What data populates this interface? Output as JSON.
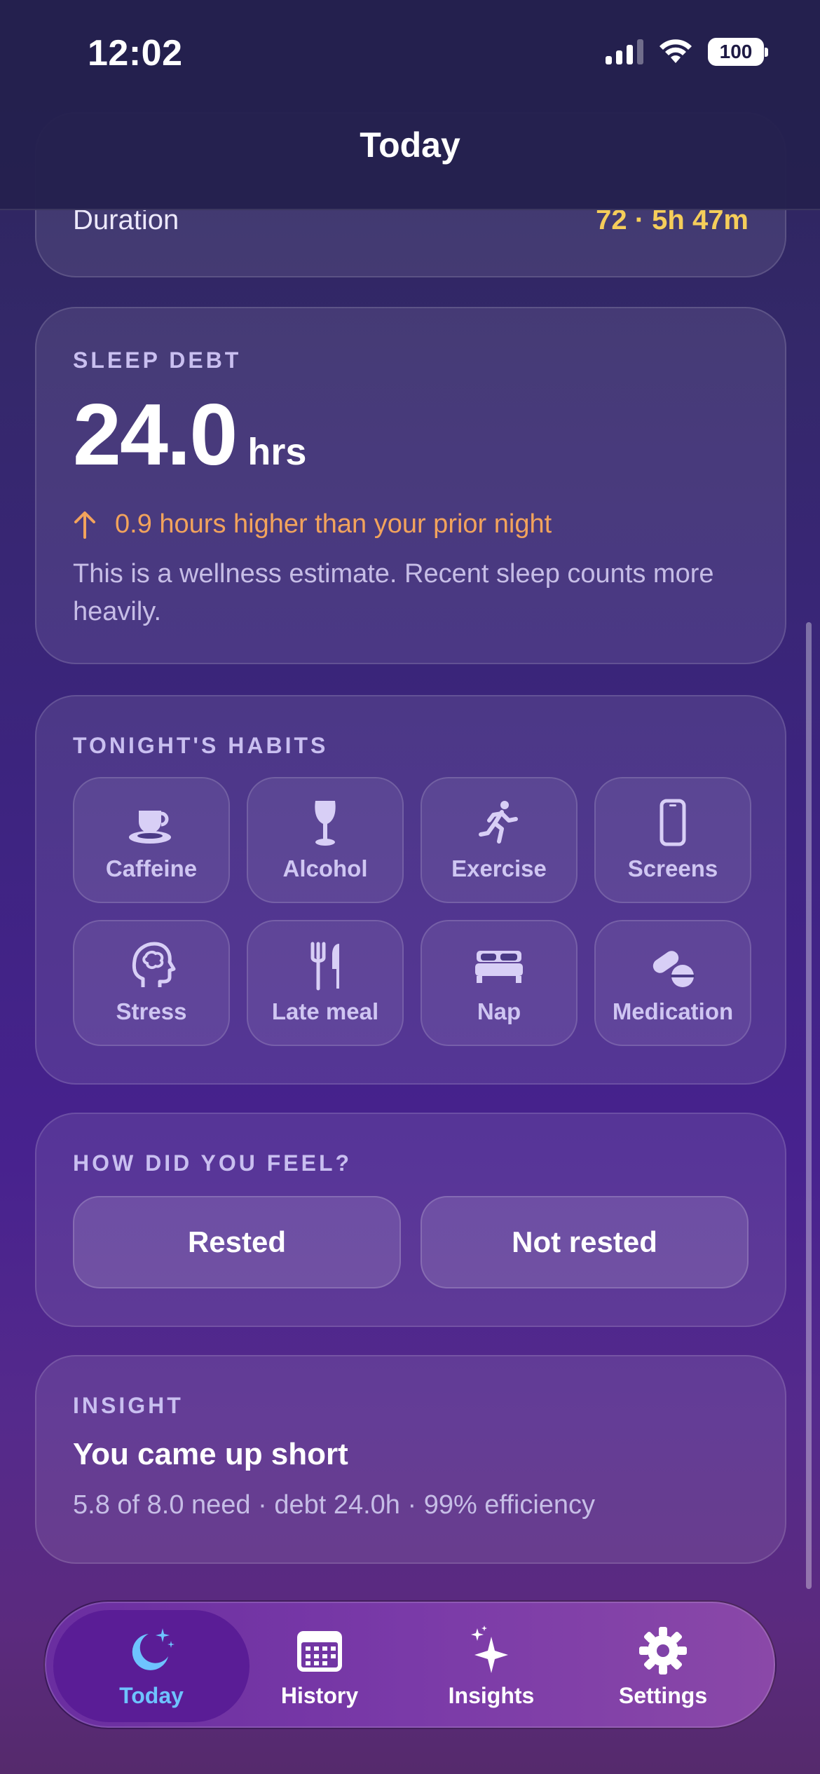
{
  "status_bar": {
    "time": "12:02",
    "battery": "100"
  },
  "header": {
    "title": "Today"
  },
  "duration": {
    "label": "Duration",
    "value": "72 · 5h 47m"
  },
  "sleep_debt": {
    "label": "SLEEP DEBT",
    "value": "24.0",
    "unit": "hrs",
    "change": "0.9 hours higher than your prior night",
    "note": "This is a wellness estimate. Recent sleep counts more heavily."
  },
  "habits": {
    "label": "TONIGHT'S HABITS",
    "items": [
      {
        "label": "Caffeine",
        "icon": "cup-icon"
      },
      {
        "label": "Alcohol",
        "icon": "wine-glass-icon"
      },
      {
        "label": "Exercise",
        "icon": "running-icon"
      },
      {
        "label": "Screens",
        "icon": "phone-icon"
      },
      {
        "label": "Stress",
        "icon": "brain-head-icon"
      },
      {
        "label": "Late meal",
        "icon": "fork-knife-icon"
      },
      {
        "label": "Nap",
        "icon": "bed-icon"
      },
      {
        "label": "Medication",
        "icon": "pills-icon"
      }
    ]
  },
  "feel": {
    "label": "HOW DID YOU FEEL?",
    "options": [
      "Rested",
      "Not rested"
    ]
  },
  "insight": {
    "label": "INSIGHT",
    "title": "You came up short",
    "detail": "5.8 of 8.0 need · debt 24.0h · 99% efficiency"
  },
  "tabs": [
    {
      "label": "Today",
      "icon": "moon-stars-icon",
      "active": true
    },
    {
      "label": "History",
      "icon": "calendar-icon",
      "active": false
    },
    {
      "label": "Insights",
      "icon": "sparkles-icon",
      "active": false
    },
    {
      "label": "Settings",
      "icon": "gear-icon",
      "active": false
    }
  ],
  "colors": {
    "accent_gold": "#f5cd5a",
    "accent_orange": "#f2a35c",
    "active_tab": "#6ec3ff"
  }
}
